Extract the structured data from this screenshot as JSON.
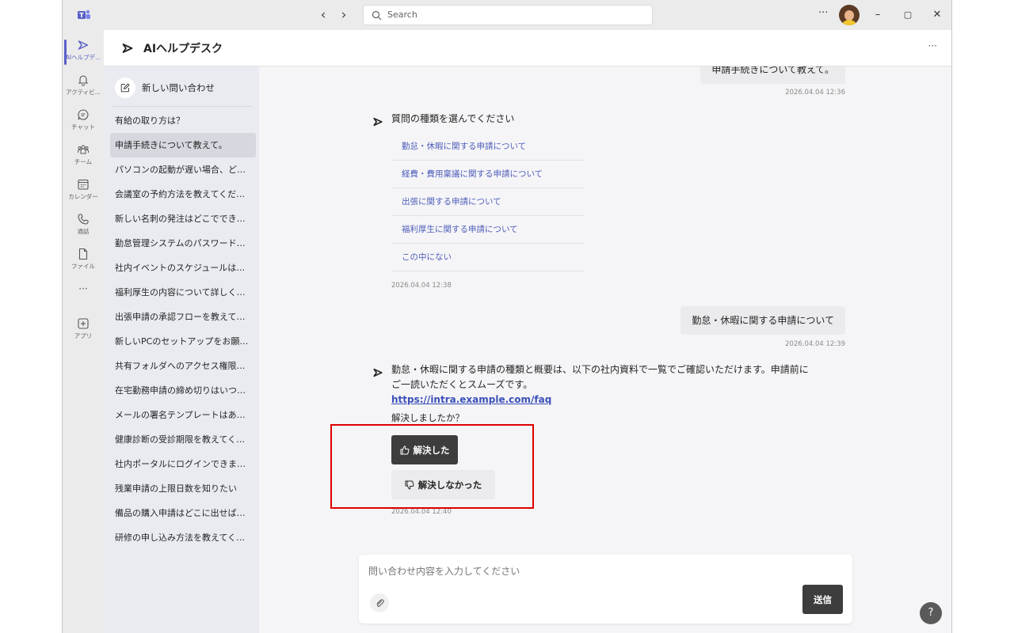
{
  "titlebar": {
    "search_placeholder": "Search",
    "more": "···",
    "back": "‹",
    "forward": "›",
    "minimize": "–",
    "maximize": "▢",
    "close": "✕"
  },
  "rail": {
    "items": [
      {
        "label": "AIヘルプデ..."
      },
      {
        "label": "アクティビ..."
      },
      {
        "label": "チャット"
      },
      {
        "label": "チーム"
      },
      {
        "label": "カレンダー"
      },
      {
        "label": "通話"
      },
      {
        "label": "ファイル"
      },
      {
        "label": "···"
      },
      {
        "label": "アプリ"
      }
    ]
  },
  "app": {
    "title": "AIヘルプデスク",
    "more": "···"
  },
  "sidebar": {
    "new_inquiry": "新しい問い合わせ",
    "history": [
      "有給の取り方は？",
      "申請手続きについて教えて。",
      "パソコンの起動が遅い場合、ど…",
      "会議室の予約方法を教えてくだ…",
      "新しい名刺の発注はどこででき…",
      "勤怠管理システムのパスワード…",
      "社内イベントのスケジュールは…",
      "福利厚生の内容について詳しく…",
      "出張申請の承認フローを教えて…",
      "新しいPCのセットアップをお願…",
      "共有フォルダへのアクセス権限…",
      "在宅勤務申請の締め切りはいつ…",
      "メールの署名テンプレートはあ…",
      "健康診断の受診期限を教えてく…",
      "社内ポータルにログインできま…",
      "残業申請の上限日数を知りたい",
      "備品の購入申請はどこに出せば…",
      "研修の申し込み方法を教えてく…"
    ]
  },
  "chat": {
    "msg1": {
      "text": "申請手続きについて教えて。",
      "time": "2026.04.04 12:36"
    },
    "bot1": {
      "text": "質問の種類を選んでください",
      "options": [
        "勤怠・休暇に関する申請について",
        "経費・費用稟議に関する申請について",
        "出張に関する申請について",
        "福利厚生に関する申請について",
        "この中にない"
      ],
      "time": "2026.04.04 12:38"
    },
    "msg2": {
      "text": "勤怠・休暇に関する申請について",
      "time": "2026.04.04 12:39"
    },
    "bot2": {
      "line1": "勤怠・休暇に関する申請の種類と概要は、以下の社内資料で一覧でご確認いただけます。申請前に",
      "line2": "ご一読いただくとスムーズです。",
      "link": "https://intra.example.com/faq",
      "question": "解決しましたか？",
      "yes": "解決した",
      "no": "解決しなかった",
      "time": "2026.04.04 12:40"
    }
  },
  "composer": {
    "placeholder": "問い合わせ内容を入力してください",
    "send": "送信"
  },
  "help": "?"
}
